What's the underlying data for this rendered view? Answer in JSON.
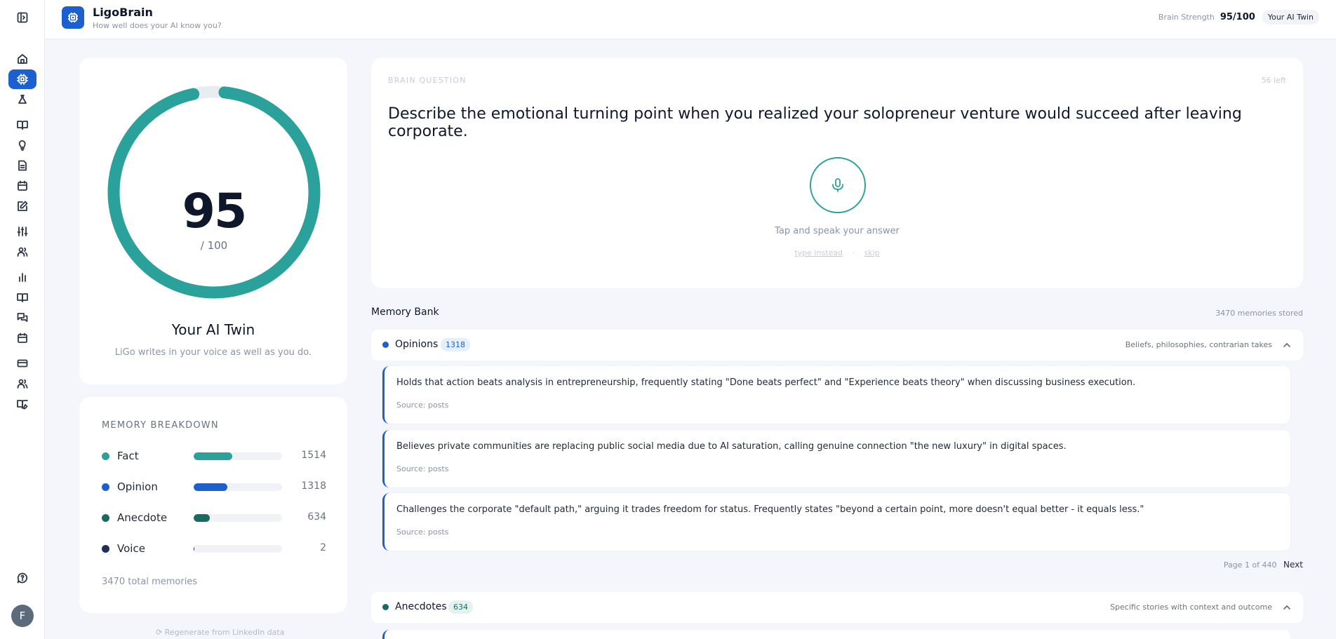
{
  "header": {
    "app_title": "LigoBrain",
    "app_subtitle": "How well does your AI know you?",
    "brain_strength_label": "Brain Strength",
    "brain_strength_value": "95/100",
    "twin_badge": "Your AI Twin"
  },
  "sidebar": {
    "items": [
      {
        "icon": "home-icon"
      },
      {
        "icon": "brain-chip-icon",
        "active": true
      },
      {
        "icon": "flask-icon"
      },
      {
        "icon": "book-open-icon"
      },
      {
        "icon": "lightbulb-icon"
      },
      {
        "icon": "document-icon"
      },
      {
        "icon": "calendar-icon"
      },
      {
        "icon": "edit-icon"
      },
      {
        "icon": "sliders-icon"
      },
      {
        "icon": "users-icon"
      },
      {
        "icon": "bar-chart-icon"
      },
      {
        "icon": "book-icon"
      },
      {
        "icon": "chat-icon"
      },
      {
        "icon": "calendar-icon"
      },
      {
        "icon": "card-icon"
      },
      {
        "icon": "team-icon"
      },
      {
        "icon": "book-edit-icon"
      },
      {
        "icon": "help-chat-icon"
      }
    ],
    "avatar_initial": "F"
  },
  "score": {
    "value": 95,
    "value_text": "95",
    "denominator": "/ 100",
    "title": "Your AI Twin",
    "description": "LiGo writes in your voice as well as you do.",
    "ring_color": "#2aa29b"
  },
  "breakdown": {
    "title": "MEMORY BREAKDOWN",
    "max": 3470,
    "rows": [
      {
        "name": "Fact",
        "count": 1514,
        "count_text": "1514",
        "color": "#2aa29b",
        "fraction": 0.436
      },
      {
        "name": "Opinion",
        "count": 1318,
        "count_text": "1318",
        "color": "#1b5fd1",
        "fraction": 0.38
      },
      {
        "name": "Anecdote",
        "count": 634,
        "count_text": "634",
        "color": "#176b63",
        "fraction": 0.183
      },
      {
        "name": "Voice",
        "count": 2,
        "count_text": "2",
        "color": "#1e2f5a",
        "fraction": 0.001
      }
    ],
    "total": "3470 total memories",
    "regenerate": "Regenerate from LinkedIn data"
  },
  "question": {
    "label": "BRAIN QUESTION",
    "left": "56 left",
    "text": "Describe the emotional turning point when you realized your solopreneur venture would succeed after leaving corporate.",
    "tap_hint": "Tap and speak your answer",
    "type_instead": "type instead",
    "separator": "·",
    "skip": "skip"
  },
  "memory_bank": {
    "title": "Memory Bank",
    "stored": "3470 memories stored",
    "opinions": {
      "name": "Opinions",
      "count": "1318",
      "description": "Beliefs, philosophies, contrarian takes",
      "color": "#1b5fd1"
    },
    "items": [
      {
        "text": "Holds that action beats analysis in entrepreneurship, frequently stating \"Done beats perfect\" and \"Experience beats theory\" when discussing business execution.",
        "source": "Source: posts"
      },
      {
        "text": "Believes private communities are replacing public social media due to AI saturation, calling genuine connection \"the new luxury\" in digital spaces.",
        "source": "Source: posts"
      },
      {
        "text": "Challenges the corporate \"default path,\" arguing it trades freedom for status. Frequently states \"beyond a certain point, more doesn't equal better - it equals less.\"",
        "source": "Source: posts"
      }
    ],
    "pager": {
      "text": "Page 1 of 440",
      "next": "Next"
    },
    "anecdotes": {
      "name": "Anecdotes",
      "count": "634",
      "description": "Specific stories with context and outcome",
      "color": "#176b63"
    }
  }
}
